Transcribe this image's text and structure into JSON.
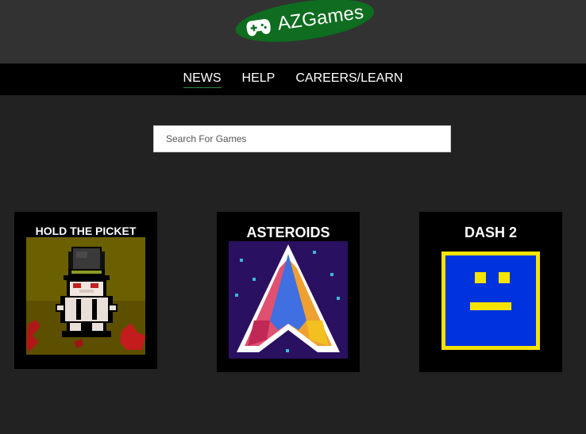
{
  "header": {
    "logo_text": "AZGames",
    "logo_icon": "gamepad-icon",
    "logo_color": "#0e6d1f"
  },
  "nav": {
    "items": [
      {
        "label": "NEWS"
      },
      {
        "label": "HELP"
      },
      {
        "label": "CAREERS/LEARN"
      }
    ]
  },
  "search": {
    "placeholder": "Search For Games"
  },
  "games": [
    {
      "title": "HOLD THE PICKET",
      "icon": "pixel-samurai-icon"
    },
    {
      "title": "ASTEROIDS",
      "icon": "pixel-spaceship-icon"
    },
    {
      "title": "DASH 2",
      "icon": "square-face-icon"
    }
  ]
}
